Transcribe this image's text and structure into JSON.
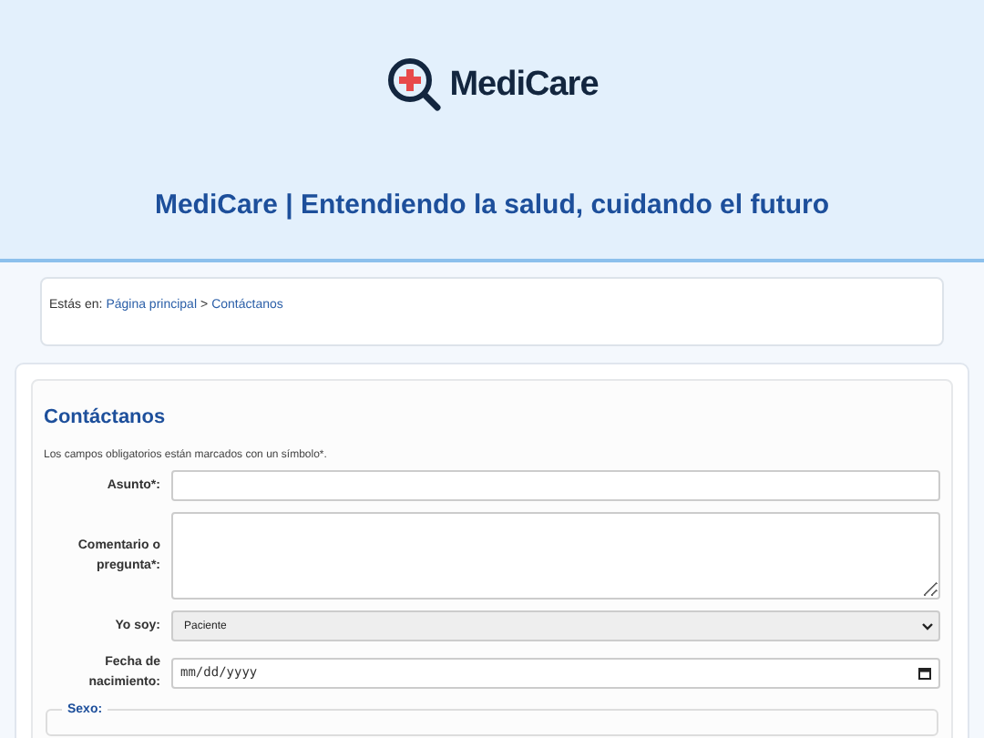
{
  "header": {
    "logo_text": "MediCare",
    "tagline": "MediCare | Entendiendo la salud, cuidando el futuro"
  },
  "breadcrumb": {
    "prefix": "Estás en:",
    "links": [
      {
        "label": "Página principal"
      },
      {
        "label": "Contáctanos"
      }
    ],
    "separator": ">"
  },
  "form": {
    "title": "Contáctanos",
    "note": "Los campos obligatorios están marcados con un símbolo*.",
    "fields": [
      {
        "kind": "text",
        "label": "Asunto*:"
      },
      {
        "kind": "textarea",
        "label": "Comentario o pregunta*:"
      },
      {
        "kind": "select",
        "label": "Yo soy:",
        "value": "Paciente"
      },
      {
        "kind": "date",
        "label": "Fecha de nacimiento:",
        "placeholder": "mm/dd/yyyy"
      }
    ],
    "fieldset": {
      "legend": "Sexo:"
    }
  }
}
